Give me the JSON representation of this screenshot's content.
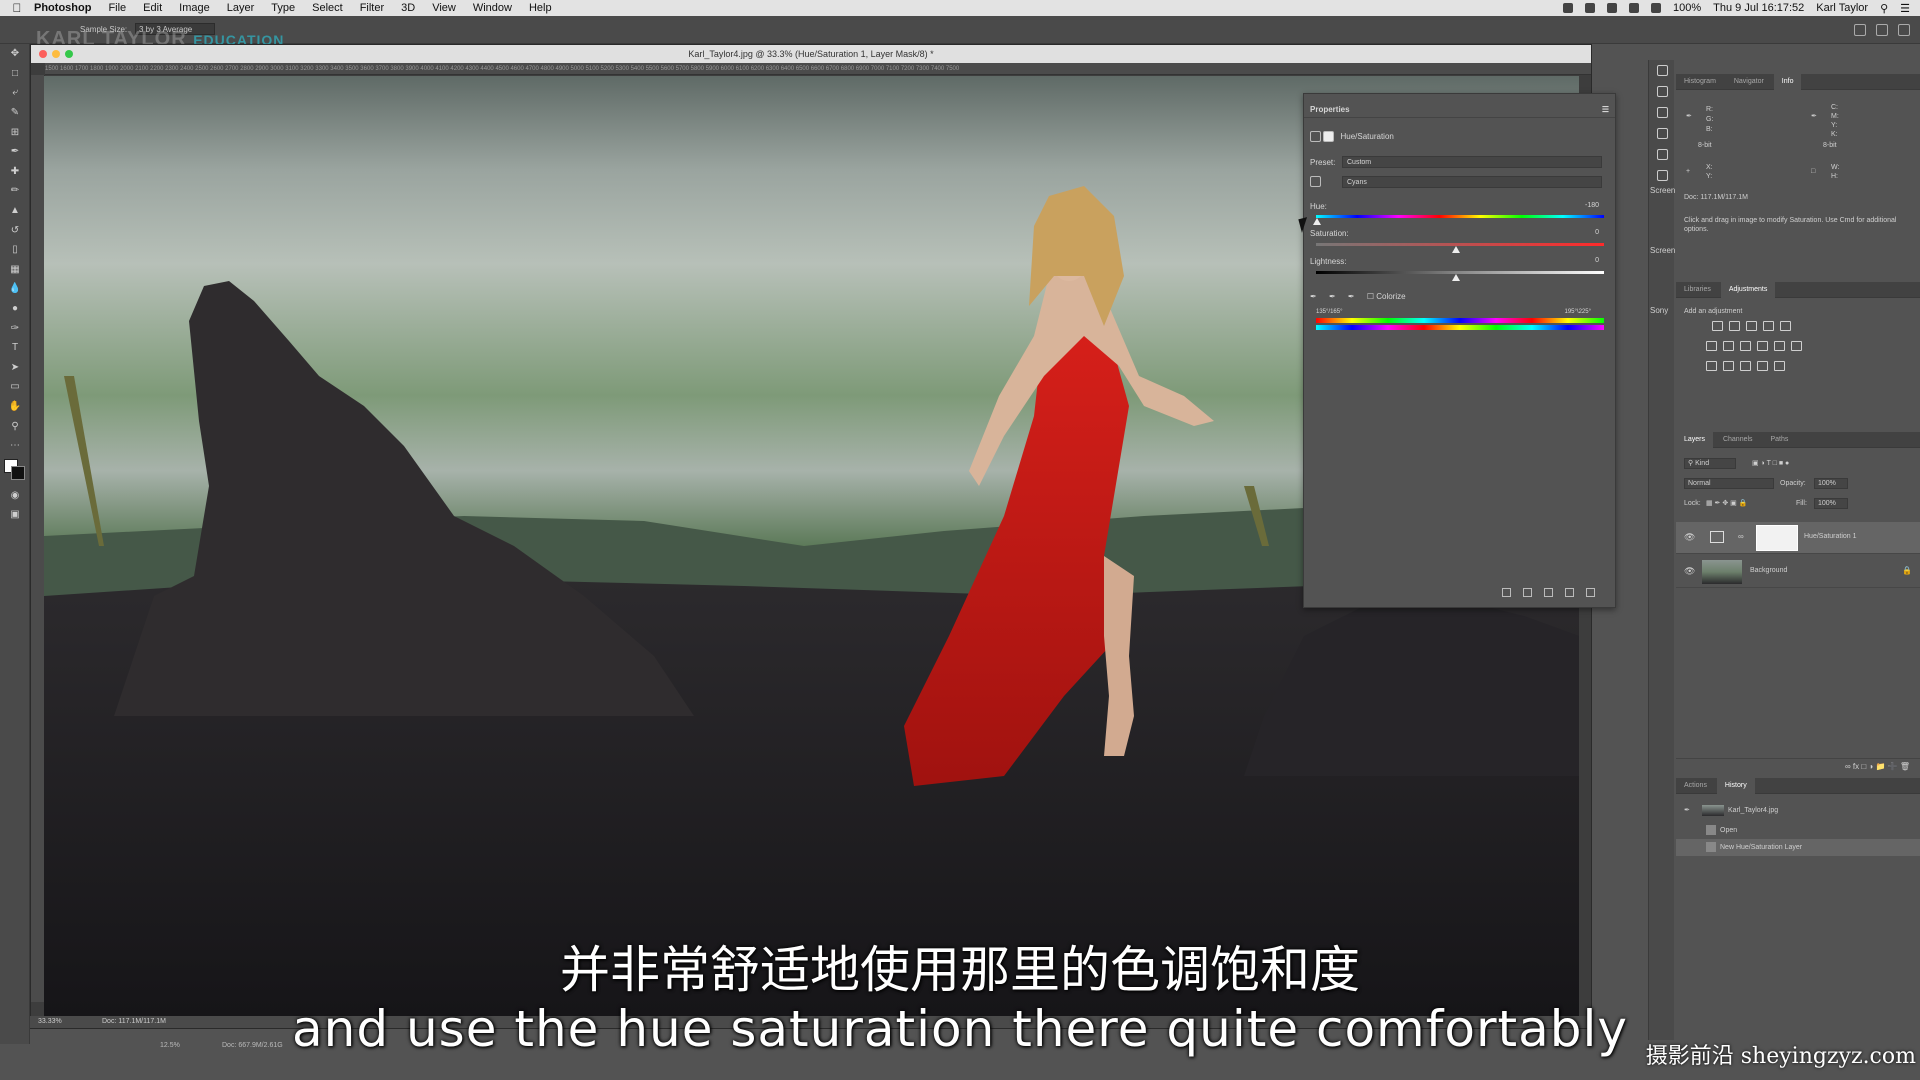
{
  "menubar": {
    "apple": "",
    "items": [
      "Photoshop",
      "File",
      "Edit",
      "Image",
      "Layer",
      "Type",
      "Select",
      "Filter",
      "3D",
      "View",
      "Window",
      "Help"
    ],
    "battery": "100%",
    "datetime": "Thu 9 Jul 16:17:52",
    "user": "Karl Taylor"
  },
  "optionsbar": {
    "sample_size_label": "Sample Size:",
    "sample_size_value": "3 by 3 Average",
    "watermark_main": "KARL TAYLOR",
    "watermark_sub": "EDUCATION"
  },
  "document": {
    "title": "Karl_Taylor4.jpg @ 33.3% (Hue/Saturation 1, Layer Mask/8) *",
    "zoom": "33.33%",
    "doc_size": "Doc: 117.1M/117.1M",
    "zoom2": "12.5%",
    "doc_size2": "Doc: 667.9M/2.61G",
    "ruler": "1500 1600 1700 1800 1900 2000 2100 2200 2300 2400 2500 2600 2700 2800 2900 3000 3100 3200 3300 3400 3500 3600 3700 3800 3900 4000 4100 4200 4300 4400 4500 4600 4700 4800 4900 5000 5100 5200 5300 5400 5500 5600 5700 5800 5900 6000 6100 6200 6300 6400 6500 6600 6700 6800 6900 7000 7100 7200 7300 7400 7500"
  },
  "properties": {
    "title": "Properties",
    "adjustment_name": "Hue/Saturation",
    "preset_label": "Preset:",
    "preset_value": "Custom",
    "channel_value": "Cyans",
    "hue_label": "Hue:",
    "hue_value": "-180",
    "saturation_label": "Saturation:",
    "saturation_value": "0",
    "lightness_label": "Lightness:",
    "lightness_value": "0",
    "colorize_label": "Colorize",
    "range_left": "135°/165°",
    "range_right": "195°\\225°",
    "accent_colors": [
      "#ff3b30",
      "#ffcc00",
      "#34c759",
      "#00c7ff",
      "#5856d6",
      "#ff2d95"
    ]
  },
  "panels": {
    "top_tabs": [
      "Histogram",
      "Navigator",
      "Info"
    ],
    "info": {
      "doc": "Doc: 117.1M/117.1M",
      "hint": "Click and drag in image to modify Saturation. Use Cmd for additional options.",
      "rgb": [
        "R:",
        "G:",
        "B:"
      ],
      "cmyk": [
        "C:",
        "M:",
        "Y:",
        "K:"
      ],
      "bit_left": "8-bit",
      "bit_right": "8-bit",
      "xy": [
        "X:",
        "Y:"
      ],
      "wh": [
        "W:",
        "H:"
      ]
    },
    "strip_labels": [
      "Screen",
      "Screen",
      "Sony"
    ],
    "adj_tabs": [
      "Libraries",
      "Adjustments"
    ],
    "adj_hint": "Add an adjustment",
    "layers_tabs": [
      "Layers",
      "Channels",
      "Paths"
    ],
    "kind_label": "Kind",
    "blend_mode": "Normal",
    "opacity_label": "Opacity:",
    "opacity_value": "100%",
    "lock_label": "Lock:",
    "fill_label": "Fill:",
    "fill_value": "100%",
    "layers": [
      {
        "name": "Hue/Saturation 1",
        "selected": true
      },
      {
        "name": "Background",
        "selected": false
      }
    ],
    "history_tabs": [
      "Actions",
      "History"
    ],
    "history": [
      {
        "name": "Karl_Taylor4.jpg"
      },
      {
        "name": "Open"
      },
      {
        "name": "New Hue/Saturation Layer"
      }
    ]
  },
  "subtitles": {
    "chinese": "并非常舒适地使用那里的色调饱和度",
    "english": "and use the hue saturation there quite comfortably",
    "site_logo": "摄影前沿 sheyingzyz.com"
  }
}
